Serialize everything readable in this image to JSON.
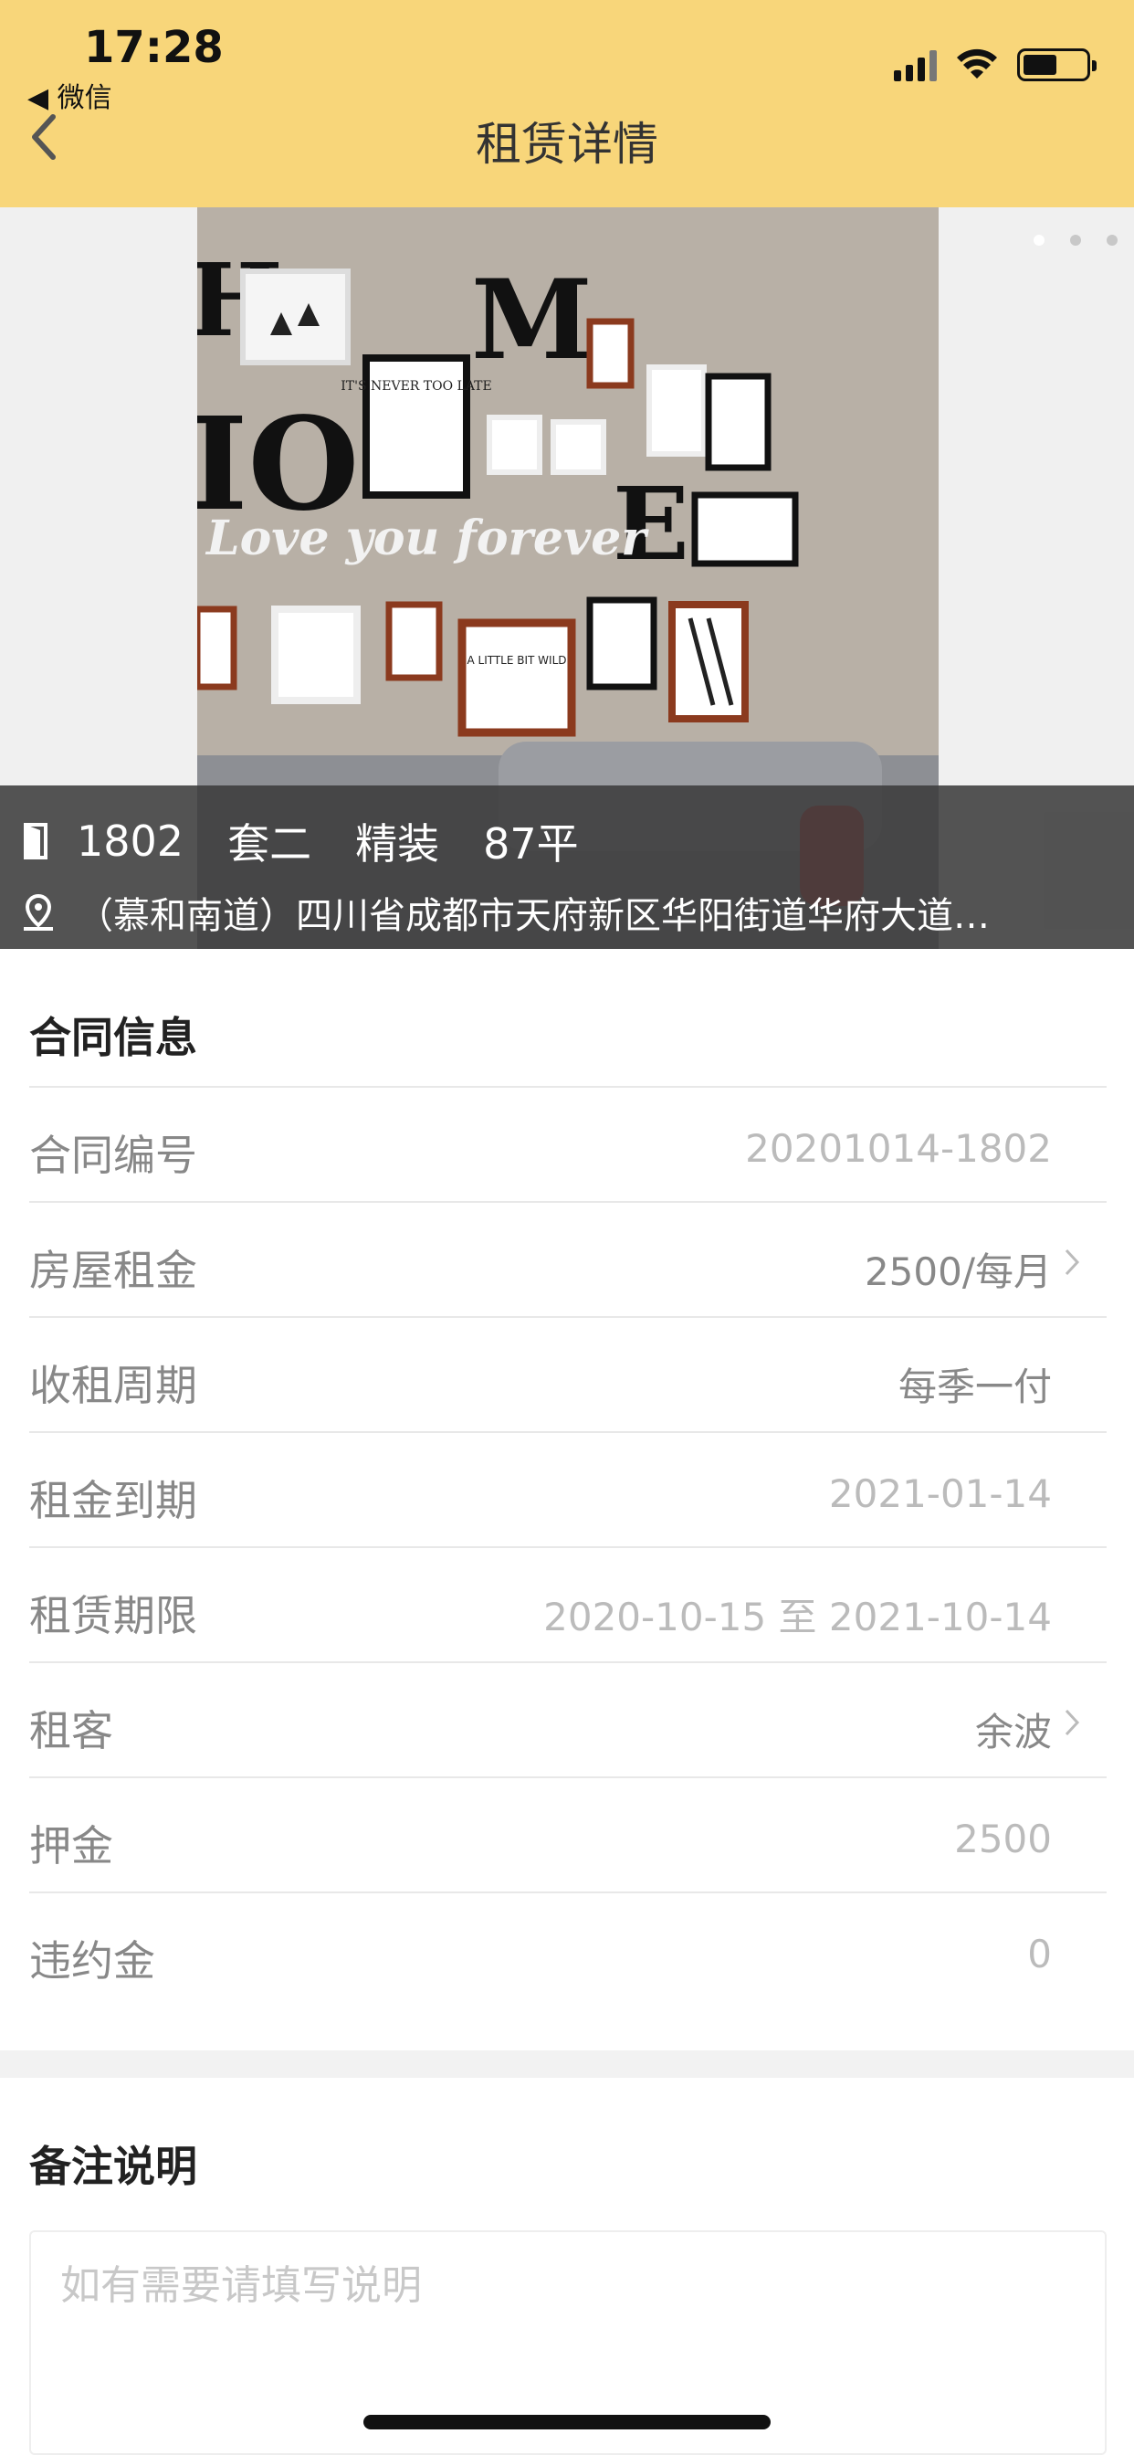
{
  "status_bar": {
    "time": "17:28",
    "back_app": "◀ 微信"
  },
  "nav": {
    "title": "租赁详情"
  },
  "hero": {
    "image_count": 3,
    "active_index": 0,
    "room": "1802",
    "layout": "套二",
    "decoration": "精装",
    "area": "87平",
    "address": "（慕和南道）四川省成都市天府新区华阳街道华府大道…",
    "photo_text": {
      "frame1": "IT'S NEVER TOO LATE",
      "banner": "Love you forever",
      "frame2": "A LITTLE BIT WILD"
    }
  },
  "contract": {
    "title": "合同信息",
    "rows": [
      {
        "label": "合同编号",
        "value": "20201014-1802"
      },
      {
        "label": "房屋租金",
        "value": "2500/每月"
      },
      {
        "label": "收租周期",
        "value": "每季一付"
      },
      {
        "label": "租金到期",
        "value": "2021-01-14"
      },
      {
        "label": "租赁期限",
        "value": "2020-10-15 至 2021-10-14"
      },
      {
        "label": "租客",
        "value": "余波"
      },
      {
        "label": "押金",
        "value": "2500"
      },
      {
        "label": "违约金",
        "value": "0"
      }
    ]
  },
  "remark": {
    "title": "备注说明",
    "placeholder": "如有需要请填写说明",
    "value": ""
  },
  "colors": {
    "header_bg": "#f8d67a",
    "overlay_bg": "#3c3c3c",
    "label": "#888888",
    "value_muted": "#bbbbbb"
  }
}
